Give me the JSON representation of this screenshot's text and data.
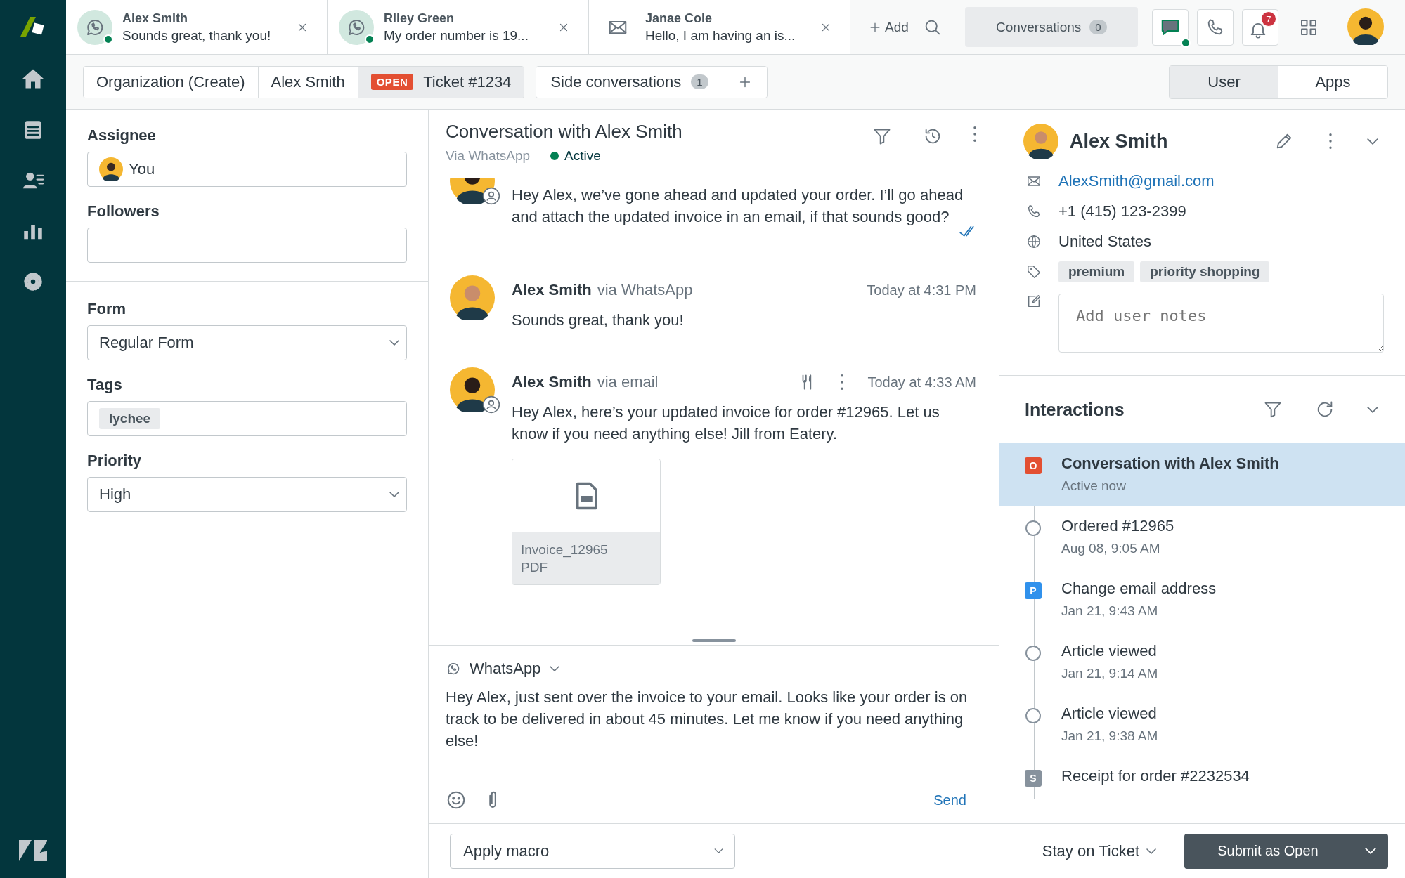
{
  "tabs": [
    {
      "kind": "whatsapp",
      "name": "Alex Smith",
      "preview": "Sounds great, thank you!",
      "online": true
    },
    {
      "kind": "whatsapp",
      "name": "Riley Green",
      "preview": "My order number is 19...",
      "online": true
    },
    {
      "kind": "email",
      "name": "Janae Cole",
      "preview": "Hello, I am having an is...",
      "online": false
    }
  ],
  "add_label": "Add",
  "conversations": {
    "label": "Conversations",
    "count": "0"
  },
  "notifications": "7",
  "breadcrumbs": [
    {
      "label": "Organization (Create)",
      "selected": false
    },
    {
      "label": "Alex Smith",
      "selected": false
    },
    {
      "label": "Ticket #1234",
      "status": "OPEN",
      "selected": true
    }
  ],
  "side_conversations": {
    "label": "Side conversations",
    "count": "1"
  },
  "context_tabs": [
    {
      "label": "User",
      "selected": true
    },
    {
      "label": "Apps",
      "selected": false
    }
  ],
  "ticket_fields": [
    {
      "kind": "person",
      "label": "Assignee",
      "value": "You"
    },
    {
      "kind": "text",
      "label": "Followers"
    },
    {
      "kind": "divider"
    },
    {
      "kind": "select",
      "label": "Form",
      "value": "Regular Form"
    },
    {
      "kind": "tags",
      "label": "Tags",
      "tags": [
        "lychee"
      ]
    },
    {
      "kind": "select",
      "label": "Priority",
      "value": "High"
    }
  ],
  "conversation": {
    "title": "Conversation with Alex Smith",
    "channel": "Via WhatsApp",
    "status": "Active",
    "messages": [
      {
        "kind": "agent",
        "text": "Hey Alex, we’ve gone ahead and updated your order. I’ll go ahead and attach the updated invoice in an email, if that sounds good?",
        "read": true
      },
      {
        "kind": "customer",
        "author": "Alex Smith",
        "via": "via WhatsApp",
        "time": "Today at 4:31 PM",
        "text": "Sounds great, thank you!"
      },
      {
        "kind": "agent",
        "author": "Alex Smith",
        "via": "via email",
        "time": "Today at 4:33 AM",
        "text": "Hey Alex, here’s your updated invoice for order #12965. Let us know if you need anything else! Jill from Eatery.",
        "attachment": {
          "name": "Invoice_12965",
          "type": "PDF"
        }
      }
    ]
  },
  "composer": {
    "channel": "WhatsApp",
    "text": "Hey Alex, just sent over the invoice to your email. Looks like your order is on track to be delivered in about 45 minutes. Let me know if you need anything else!",
    "send": "Send"
  },
  "footer": {
    "macro": "Apply macro",
    "stay": "Stay on Ticket",
    "submit": "Submit as Open"
  },
  "user": {
    "name": "Alex Smith",
    "email": "AlexSmith@gmail.com",
    "phone": "+1 (415) 123-2399",
    "country": "United States",
    "tags": [
      "premium",
      "priority shopping"
    ],
    "notes_placeholder": "Add user notes"
  },
  "interactions": {
    "title": "Interactions",
    "items": [
      {
        "kind": "badge",
        "badge": "O",
        "color": "#e34f32",
        "title": "Conversation with Alex Smith",
        "subtitle": "Active now",
        "selected": true
      },
      {
        "kind": "event",
        "title": "Ordered #12965",
        "subtitle": "Aug 08, 9:05 AM",
        "selected": false
      },
      {
        "kind": "badge",
        "badge": "P",
        "color": "#3091ec",
        "title": "Change email address",
        "subtitle": "Jan 21, 9:43 AM",
        "selected": false
      },
      {
        "kind": "event",
        "title": "Article viewed",
        "subtitle": "Jan 21, 9:14 AM",
        "selected": false
      },
      {
        "kind": "event",
        "title": "Article viewed",
        "subtitle": "Jan 21, 9:38 AM",
        "selected": false
      },
      {
        "kind": "badge",
        "badge": "S",
        "color": "#87929d",
        "title": "Receipt for order #2232534",
        "selected": false
      }
    ]
  }
}
